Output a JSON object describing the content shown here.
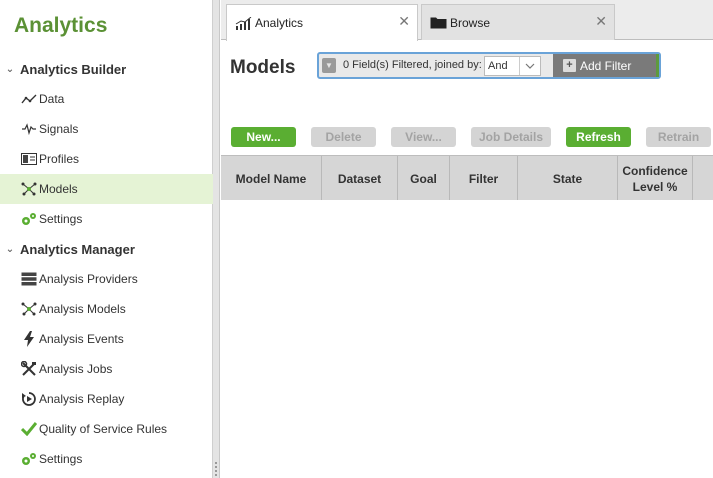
{
  "app": {
    "title": "Analytics"
  },
  "sidebar": {
    "groups": [
      {
        "label": "Analytics Builder",
        "items": [
          {
            "label": "Data",
            "icon": "line-chart-icon"
          },
          {
            "label": "Signals",
            "icon": "signal-wave-icon"
          },
          {
            "label": "Profiles",
            "icon": "profile-card-icon"
          },
          {
            "label": "Models",
            "icon": "network-icon",
            "active": true
          },
          {
            "label": "Settings",
            "icon": "gears-icon"
          }
        ]
      },
      {
        "label": "Analytics Manager",
        "items": [
          {
            "label": "Analysis Providers",
            "icon": "server-icon"
          },
          {
            "label": "Analysis Models",
            "icon": "network-icon"
          },
          {
            "label": "Analysis Events",
            "icon": "lightning-icon"
          },
          {
            "label": "Analysis Jobs",
            "icon": "tools-icon"
          },
          {
            "label": "Analysis Replay",
            "icon": "replay-icon"
          },
          {
            "label": "Quality of Service Rules",
            "icon": "checkmark-icon"
          },
          {
            "label": "Settings",
            "icon": "gears-icon"
          }
        ]
      }
    ]
  },
  "tabs": [
    {
      "label": "Analytics",
      "icon": "analytics-bars-icon",
      "active": true
    },
    {
      "label": "Browse",
      "icon": "folder-icon",
      "active": false
    }
  ],
  "main": {
    "title": "Models",
    "filter": {
      "summary": "0 Field(s) Filtered, joined by:",
      "join_value": "And",
      "add_label": "Add Filter"
    },
    "toolbar": [
      {
        "label": "New...",
        "enabled": true
      },
      {
        "label": "Delete",
        "enabled": false
      },
      {
        "label": "View...",
        "enabled": false
      },
      {
        "label": "Job Details",
        "enabled": false
      },
      {
        "label": "Refresh",
        "enabled": true
      },
      {
        "label": "Retrain",
        "enabled": false
      }
    ],
    "grid": {
      "columns": [
        "Model Name",
        "Dataset",
        "Goal",
        "Filter",
        "State",
        "Confidence Level %"
      ]
    }
  },
  "colors": {
    "brand_green": "#5b9135",
    "button_green": "#5aae32",
    "active_nav_bg": "#e5f3d5",
    "filter_border": "#6aa3d8"
  }
}
